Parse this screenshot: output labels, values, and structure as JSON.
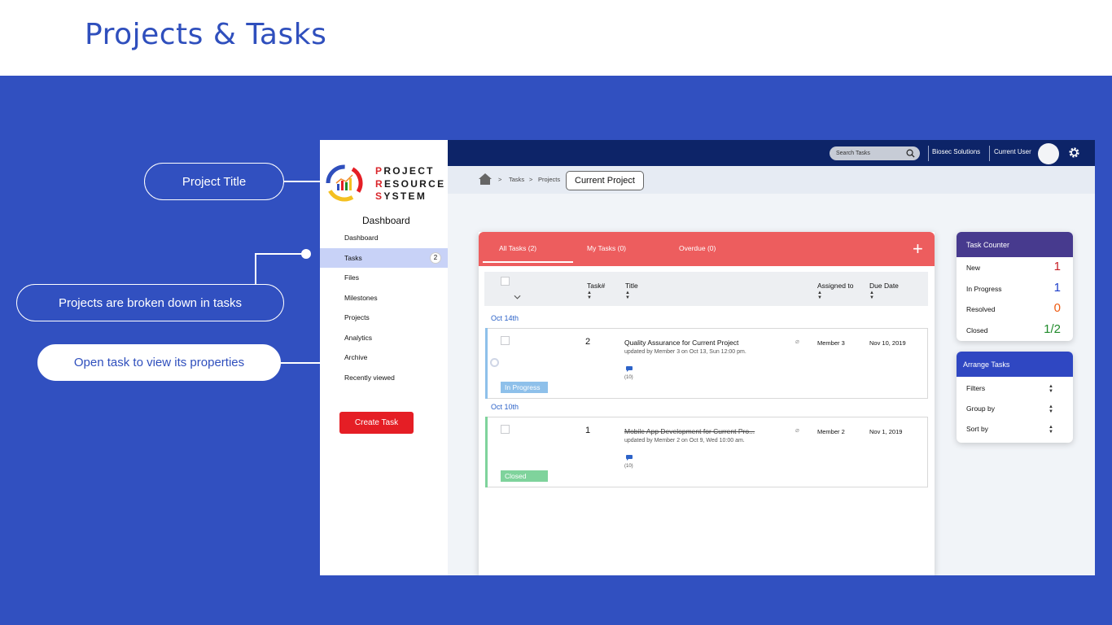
{
  "slide": {
    "title": "Projects & Tasks"
  },
  "callouts": {
    "project_title": "Project Title",
    "broken_down": "Projects are broken down in tasks",
    "open_task": "Open task to view its properties"
  },
  "logo": {
    "line1": "PROJECT",
    "line2": "RESOURCE",
    "line3": "SYSTEM",
    "first1": "P",
    "rest1": "ROJECT",
    "first2": "R",
    "rest2": "ESOURCE",
    "first3": "S",
    "rest3": "YSTEM"
  },
  "sidebar": {
    "heading": "Dashboard",
    "items": [
      {
        "label": "Dashboard"
      },
      {
        "label": "Tasks",
        "badge": "2"
      },
      {
        "label": "Files"
      },
      {
        "label": "Milestones"
      },
      {
        "label": "Projects"
      },
      {
        "label": "Analytics"
      },
      {
        "label": "Archive"
      },
      {
        "label": "Recently viewed"
      }
    ],
    "create_label": "Create Task"
  },
  "topbar": {
    "search_placeholder": "Search Tasks",
    "company": "Biosec Solutions",
    "user": "Current User"
  },
  "breadcrumb": {
    "tasks": "Tasks",
    "projects": "Projects",
    "current": "Current Project"
  },
  "tabs": {
    "all": "All Tasks (2)",
    "mine": "My Tasks (0)",
    "overdue": "Overdue (0)"
  },
  "table": {
    "headers": {
      "task_num": "Task#",
      "title": "Title",
      "assigned": "Assigned to",
      "due": "Due Date"
    },
    "groups": [
      {
        "date": "Oct 14th",
        "task": {
          "num": "2",
          "title": "Quality Assurance for Current Project",
          "sub": "updated by Member 3 on Oct 13, Sun 12:00 pm.",
          "comments": "(10)",
          "assignee": "Member 3",
          "due": "Nov 10, 2019",
          "status": "In Progress",
          "status_color": "#8ec0ea"
        }
      },
      {
        "date": "Oct 10th",
        "task": {
          "num": "1",
          "title": "Mobile App Development for Current Pro...",
          "sub": "updated by Member 2 on Oct 9, Wed 10:00 am.",
          "comments": "(10)",
          "assignee": "Member 2",
          "due": "Nov 1, 2019",
          "status": "Closed",
          "status_color": "#7fd39c"
        }
      }
    ]
  },
  "counter": {
    "title": "Task Counter",
    "rows": [
      {
        "label": "New",
        "value": "1",
        "color": "#c61d24"
      },
      {
        "label": "In Progress",
        "value": "1",
        "color": "#1c3ec9"
      },
      {
        "label": "Resolved",
        "value": "0",
        "color": "#ee5b12"
      },
      {
        "label": "Closed",
        "value": "1/2",
        "color": "#1f8a2a"
      }
    ]
  },
  "arrange": {
    "title": "Arrange Tasks",
    "rows": [
      {
        "label": "Filters"
      },
      {
        "label": "Group by"
      },
      {
        "label": "Sort by"
      }
    ]
  },
  "colors": {
    "slide_blue": "#3150c0",
    "topbar": "#0d2468",
    "tabs_red": "#ed5d5e",
    "counter_head": "#473a8e",
    "arrange_head": "#2f47c2",
    "create_red": "#e51e25"
  }
}
